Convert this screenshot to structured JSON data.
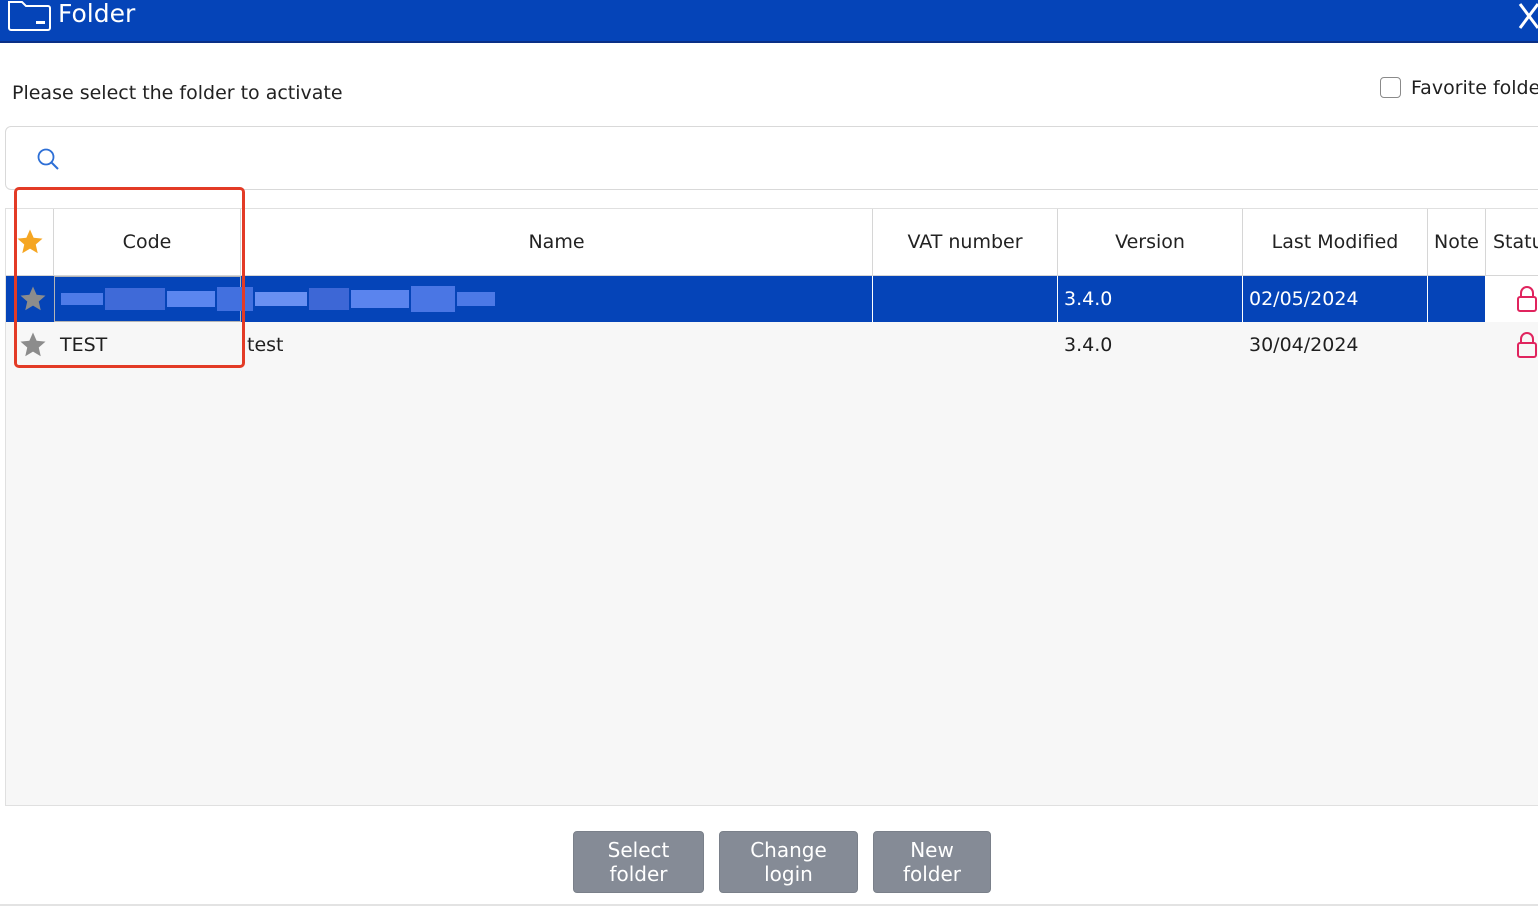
{
  "window": {
    "title": "Folder",
    "close_icon": "close-icon",
    "folder_icon": "folder-icon"
  },
  "prompt_text": "Please select the folder to activate",
  "favorite_filter": {
    "label": "Favorite folder",
    "checked": false
  },
  "search": {
    "placeholder": "",
    "value": "",
    "icon": "search-icon"
  },
  "table": {
    "columns": [
      "",
      "Code",
      "Name",
      "VAT number",
      "Version",
      "Last Modified",
      "Note",
      "Status"
    ],
    "rows": [
      {
        "favorite": false,
        "code": "",
        "name": "",
        "vat_number": "",
        "version": "3.4.0",
        "last_modified": "02/05/2024",
        "note": "",
        "status_icon": "lock-icon",
        "selected": true,
        "redacted": true
      },
      {
        "favorite": false,
        "code": "TEST",
        "name": "test",
        "vat_number": "",
        "version": "3.4.0",
        "last_modified": "30/04/2024",
        "note": "",
        "status_icon": "lock-icon",
        "selected": false,
        "redacted": false
      }
    ]
  },
  "buttons": {
    "select": "Select folder",
    "change_login": "Change login",
    "new_folder": "New folder"
  },
  "colors": {
    "header_bar": "#0544b8",
    "selected_row": "#0544b8",
    "star_active": "#f5a623",
    "star_inactive": "#8c8c8c",
    "lock": "#e0245e",
    "button": "#858b96",
    "annotation": "#e33b26"
  }
}
